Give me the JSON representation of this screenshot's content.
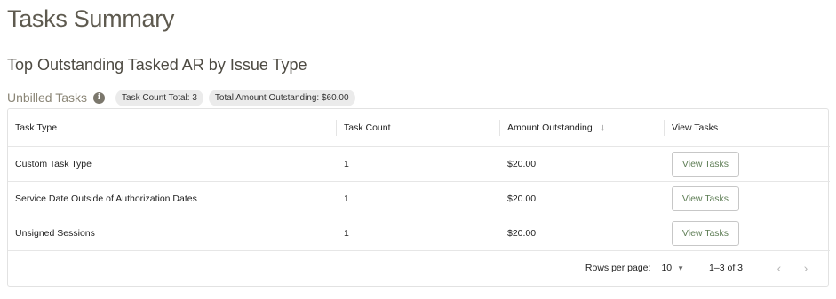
{
  "page": {
    "title": "Tasks Summary"
  },
  "section": {
    "title": "Top Outstanding Tasked AR by Issue Type"
  },
  "subheader": {
    "title": "Unbilled Tasks",
    "info_icon": "i",
    "task_count_chip": "Task Count Total: 3",
    "amount_chip": "Total Amount Outstanding: $60.00"
  },
  "table": {
    "headers": {
      "task_type": "Task Type",
      "task_count": "Task Count",
      "amount": "Amount Outstanding",
      "amount_sort_icon": "↓",
      "view": "View Tasks"
    },
    "rows": [
      {
        "task_type": "Custom Task Type",
        "task_count": "1",
        "amount": "$20.00",
        "action": "View Tasks"
      },
      {
        "task_type": "Service Date Outside of Authorization Dates",
        "task_count": "1",
        "amount": "$20.00",
        "action": "View Tasks"
      },
      {
        "task_type": "Unsigned Sessions",
        "task_count": "1",
        "amount": "$20.00",
        "action": "View Tasks"
      }
    ]
  },
  "pagination": {
    "rows_label": "Rows per page:",
    "rows_value": "10",
    "caret": "▼",
    "range": "1–3 of 3",
    "prev": "‹",
    "next": "›"
  },
  "colors": {
    "accent": "#5f7e56",
    "title": "#5e5a4f",
    "chip_bg": "#ebebeb"
  }
}
